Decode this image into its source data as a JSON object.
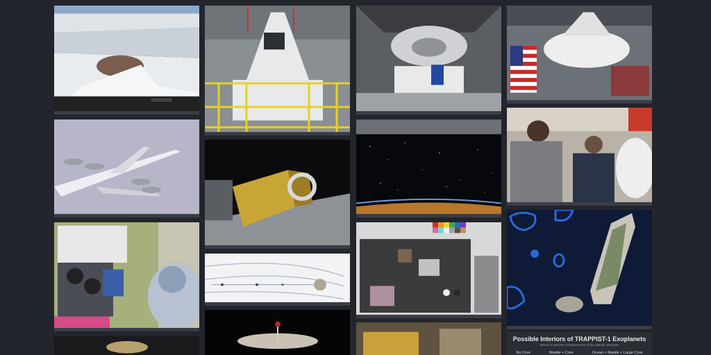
{
  "gallery": {
    "tiles": [
      {
        "id": "glacier",
        "subject": "ice-shelf-aerial"
      },
      {
        "id": "plane",
        "subject": "aircraft-flight"
      },
      {
        "id": "rover",
        "subject": "rover-camera-lab"
      },
      {
        "id": "capsule",
        "subject": "capsule-in-scaffold"
      },
      {
        "id": "instrument",
        "subject": "gold-instrument"
      },
      {
        "id": "diagram",
        "subject": "trajectory-diagram"
      },
      {
        "id": "dish",
        "subject": "antenna-dish"
      },
      {
        "id": "interior",
        "subject": "spacecraft-interior"
      },
      {
        "id": "stars",
        "subject": "earth-limb-stars"
      },
      {
        "id": "samples",
        "subject": "calibration-samples"
      },
      {
        "id": "flag",
        "subject": "capsule-with-flag"
      },
      {
        "id": "astro",
        "subject": "astronauts-station"
      },
      {
        "id": "island",
        "subject": "island-satellite"
      }
    ]
  },
  "trappist": {
    "title": "Possible Interiors of TRAPPIST-1 Exoplanets",
    "subtitle": "Based on precise measurements of the planets' densities",
    "columns": [
      "No Core",
      "Mantle + Core",
      "Ocean + Mantle + Large Core"
    ]
  },
  "colors": {
    "background": "#22252c",
    "tile_border": "#3a3d44",
    "scaffold_yellow": "#e8d21c"
  }
}
